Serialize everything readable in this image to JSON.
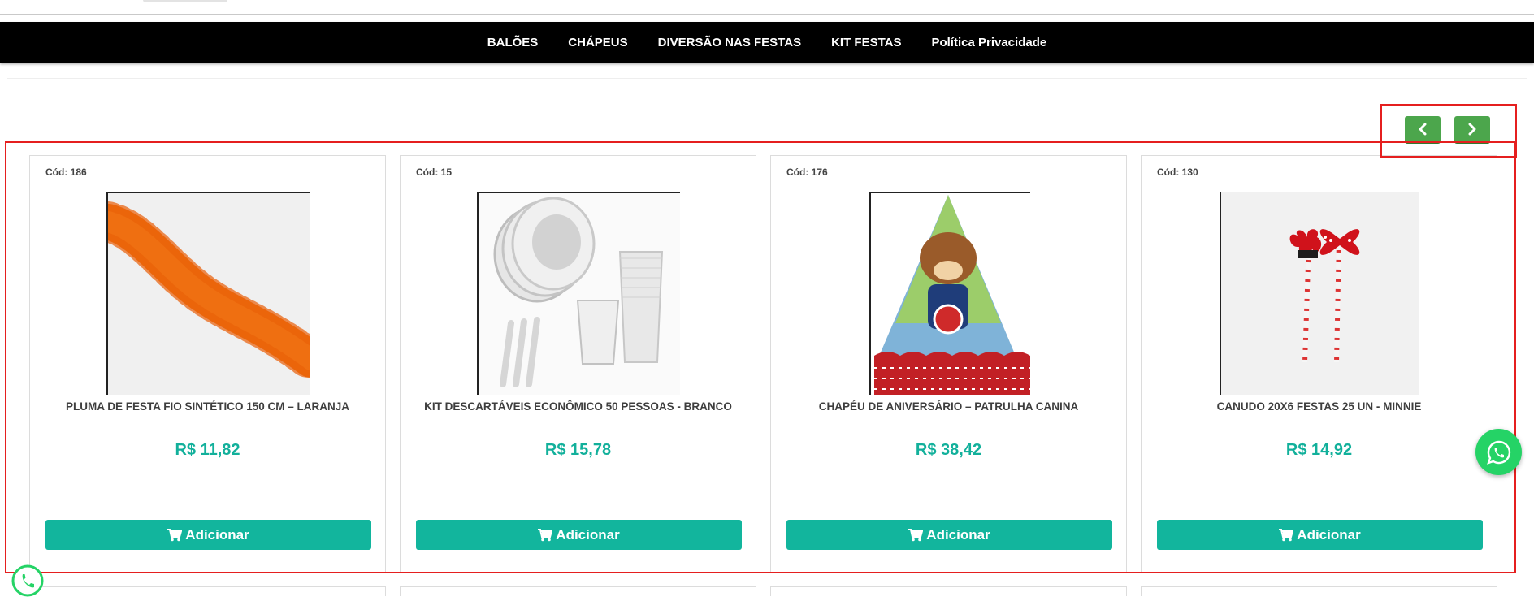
{
  "nav": {
    "items": [
      "BALÕES",
      "CHÁPEUS",
      "DIVERSÃO NAS FESTAS",
      "KIT FESTAS",
      "Política Privacidade"
    ]
  },
  "carousel": {
    "products": [
      {
        "code": "Cód: 186",
        "title": "PLUMA DE FESTA FIO SINTÉTICO 150 CM – LARANJA",
        "price": "R$ 11,82",
        "button": "Adicionar",
        "image": "orange-feather-boa"
      },
      {
        "code": "Cód: 15",
        "title": "KIT DESCARTÁVEIS ECONÔMICO 50 PESSOAS - BRANCO",
        "price": "R$ 15,78",
        "button": "Adicionar",
        "image": "plates-cups-forks"
      },
      {
        "code": "Cód: 176",
        "title": "CHAPÉU DE ANIVERSÁRIO – PATRULHA CANINA",
        "price": "R$ 38,42",
        "button": "Adicionar",
        "image": "paw-patrol-party-hat"
      },
      {
        "code": "Cód: 130",
        "title": "CANUDO 20X6 FESTAS 25 UN - MINNIE",
        "price": "R$ 14,92",
        "button": "Adicionar",
        "image": "minnie-straws"
      }
    ]
  },
  "icons": {
    "prev": "chevron-left-icon",
    "next": "chevron-right-icon",
    "cart": "cart-icon",
    "whatsapp": "whatsapp-icon"
  },
  "colors": {
    "nav_bg": "#000000",
    "price": "#12b09b",
    "add_button": "#12b59d",
    "arrow_button": "#4ca64c",
    "whatsapp": "#25d366",
    "annotation": "#e51f1f"
  }
}
